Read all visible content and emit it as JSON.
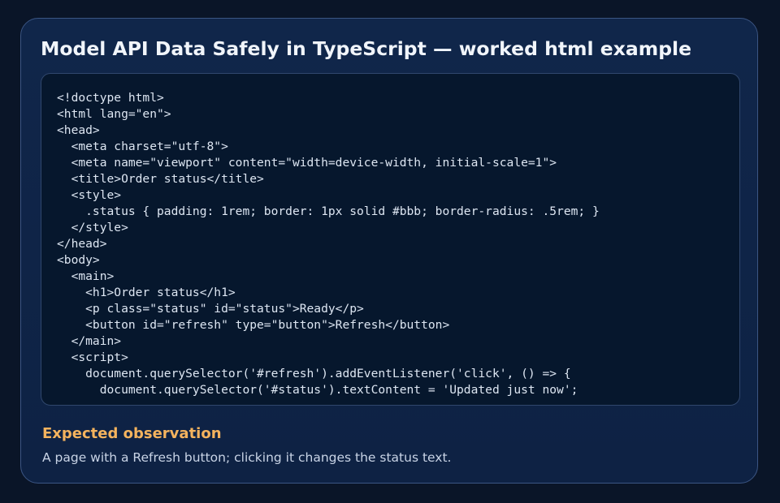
{
  "card": {
    "title": "Model API Data Safely in TypeScript — worked html example"
  },
  "code": {
    "lines": [
      "<!doctype html>",
      "<html lang=\"en\">",
      "<head>",
      "  <meta charset=\"utf-8\">",
      "  <meta name=\"viewport\" content=\"width=device-width, initial-scale=1\">",
      "  <title>Order status</title>",
      "  <style>",
      "    .status { padding: 1rem; border: 1px solid #bbb; border-radius: .5rem; }",
      "  </style>",
      "</head>",
      "<body>",
      "  <main>",
      "    <h1>Order status</h1>",
      "    <p class=\"status\" id=\"status\">Ready</p>",
      "    <button id=\"refresh\" type=\"button\">Refresh</button>",
      "  </main>",
      "  <script>",
      "    document.querySelector('#refresh').addEventListener('click', () => {",
      "      document.querySelector('#status').textContent = 'Updated just now';"
    ]
  },
  "observation": {
    "heading": "Expected observation",
    "text": "A page with a Refresh button; clicking it changes the status text."
  },
  "colors": {
    "page_background": "#0a1528",
    "card_background": "#10264a",
    "card_border": "#3b5583",
    "code_background": "#06172d",
    "heading_accent": "#f4b35e"
  }
}
